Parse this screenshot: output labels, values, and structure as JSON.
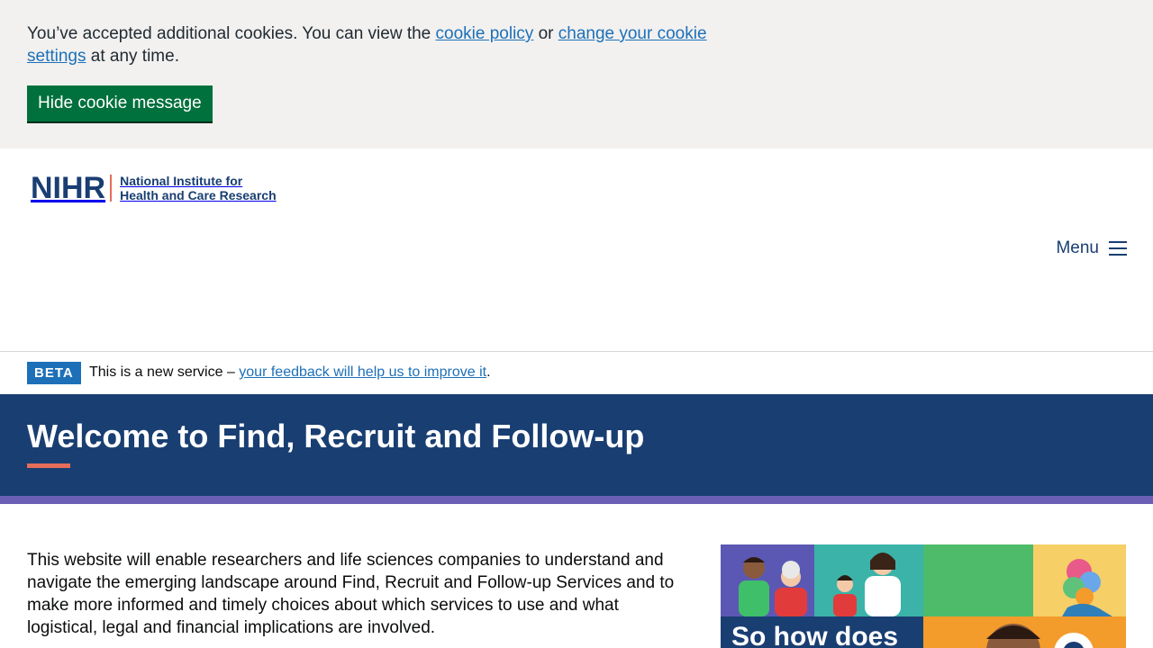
{
  "cookie_banner": {
    "text_before": "You’ve accepted additional cookies. You can view the ",
    "policy_link": "cookie policy",
    "text_or": " or ",
    "settings_link": "change your cookie settings",
    "text_after": " at any time.",
    "hide_button": "Hide cookie message"
  },
  "header": {
    "logo_mark": "NIHR",
    "logo_line1": "National Institute for",
    "logo_line2": "Health and Care Research",
    "menu_label": "Menu",
    "menu_icon": "hamburger-icon"
  },
  "beta": {
    "tag": "BETA",
    "text": "This is a new service – ",
    "link": "your feedback will help us to improve it",
    "period": "."
  },
  "hero": {
    "title": "Welcome to Find, Recruit and Follow-up"
  },
  "main": {
    "intro": "This website will enable researchers and life sciences companies to understand and navigate the emerging landscape around Find, Recruit and Follow-up Services and to make more informed and timely choices about which services to use and what logistical, legal and financial implications are involved.",
    "promo_caption": "So how does"
  },
  "colors": {
    "brand_navy": "#193e72",
    "accent_coral": "#e56d5a",
    "stripe_purple": "#6b5fb5",
    "button_green": "#00703c",
    "link_blue": "#1d70b8"
  }
}
